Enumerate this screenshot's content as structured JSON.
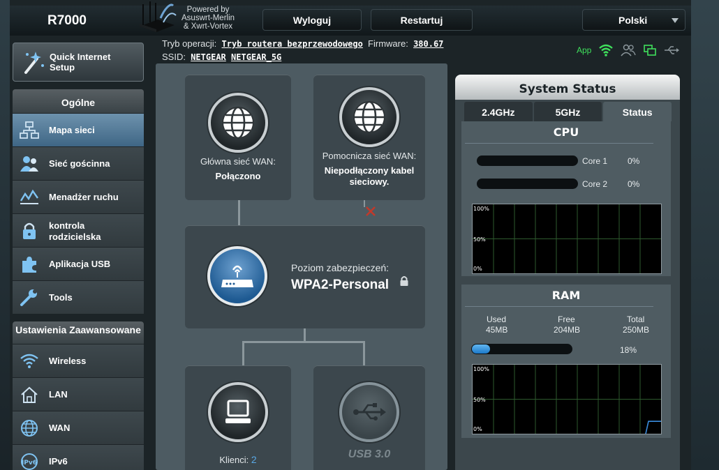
{
  "header": {
    "model": "R7000",
    "powered_by": [
      "Powered by",
      "Asuswrt-Merlin",
      "& Xwrt-Vortex"
    ],
    "logout_label": "Wyloguj",
    "restart_label": "Restartuj",
    "language": "Polski"
  },
  "info": {
    "mode_label": "Tryb operacji:",
    "mode_value": "Tryb routera bezprzewodowego",
    "firmware_label": "Firmware:",
    "firmware_value": "380.67",
    "ssid_label": "SSID:",
    "ssid_24": "NETGEAR",
    "ssid_5": "NETGEAR_5G",
    "app_label": "App"
  },
  "sidebar": {
    "qis_label": [
      "Quick Internet",
      "Setup"
    ],
    "general_title": "Ogólne",
    "general_items": [
      {
        "label": "Mapa sieci",
        "icon": "network-map-icon",
        "active": true
      },
      {
        "label": "Sieć gościnna",
        "icon": "guest-network-icon"
      },
      {
        "label": "Menadżer ruchu",
        "icon": "traffic-manager-icon"
      },
      {
        "label": "kontrola rodzicielska",
        "label1": "kontrola",
        "label2": "rodzicielska",
        "icon": "parental-control-icon"
      },
      {
        "label": "Aplikacja USB",
        "icon": "usb-app-icon"
      },
      {
        "label": "Tools",
        "icon": "tools-icon"
      }
    ],
    "advanced_title": "Ustawienia Zaawansowane",
    "advanced_items": [
      {
        "label": "Wireless",
        "icon": "wireless-icon"
      },
      {
        "label": "LAN",
        "icon": "lan-icon"
      },
      {
        "label": "WAN",
        "icon": "wan-icon"
      },
      {
        "label": "IPv6",
        "icon": "ipv6-icon"
      }
    ]
  },
  "map": {
    "primary_wan_label": "Główna sieć WAN:",
    "primary_wan_status": "Połączono",
    "secondary_wan_label": "Pomocnicza sieć WAN:",
    "secondary_wan_status": "Niepodłączony kabel sieciowy.",
    "security_label": "Poziom zabezpieczeń:",
    "security_value": "WPA2-Personal",
    "clients_label": "Klienci:",
    "clients_count": "2",
    "usb_label": "USB 3.0"
  },
  "system_status": {
    "title": "System Status",
    "tabs": [
      "2.4GHz",
      "5GHz",
      "Status"
    ],
    "active_tab": "Status",
    "cpu_title": "CPU",
    "cores": [
      {
        "name": "Core 1",
        "percent": "0%",
        "value": 0
      },
      {
        "name": "Core 2",
        "percent": "0%",
        "value": 0
      }
    ],
    "cpu_graph_labels": [
      "100%",
      "50%",
      "0%"
    ],
    "ram_title": "RAM",
    "ram_used_label": "Used",
    "ram_used": "45MB",
    "ram_free_label": "Free",
    "ram_free": "204MB",
    "ram_total_label": "Total",
    "ram_total": "250MB",
    "ram_percent": "18%",
    "ram_fraction": 0.18,
    "ram_graph_labels": [
      "100%",
      "50%",
      "0%"
    ]
  },
  "colors": {
    "accent_blue": "#1c79c9",
    "app_green": "#3fe05c",
    "error_red": "#c0392b"
  }
}
